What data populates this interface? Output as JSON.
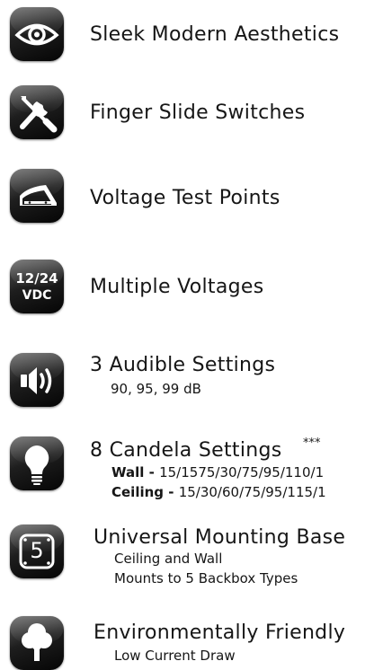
{
  "features": [
    {
      "icon": "eye-icon",
      "title": "Sleek Modern Aesthetics"
    },
    {
      "icon": "tools-icon",
      "title": "Finger Slide Switches"
    },
    {
      "icon": "test-points-icon",
      "title": "Voltage Test Points"
    },
    {
      "icon": "voltage-badge-icon",
      "icon_text_top": "12/24",
      "icon_text_bottom": "VDC",
      "title": "Multiple Voltages"
    },
    {
      "icon": "speaker-icon",
      "title": "3 Audible Settings",
      "lines": [
        "90, 95, 99 dB"
      ]
    },
    {
      "icon": "lightbulb-icon",
      "title": "8 Candela Settings",
      "stars": "***",
      "lines": [
        {
          "label": "Wall - ",
          "value": "15/1575/30/75/95/110/1"
        },
        {
          "label": "Ceiling - ",
          "value": "15/30/60/75/95/115/1"
        }
      ]
    },
    {
      "icon": "mounting-base-icon",
      "icon_text": "5",
      "title": "Universal Mounting Base",
      "lines": [
        "Ceiling and Wall",
        "Mounts to 5 Backbox Types"
      ]
    },
    {
      "icon": "tree-icon",
      "title": "Environmentally Friendly",
      "lines": [
        "Low Current Draw"
      ]
    }
  ]
}
